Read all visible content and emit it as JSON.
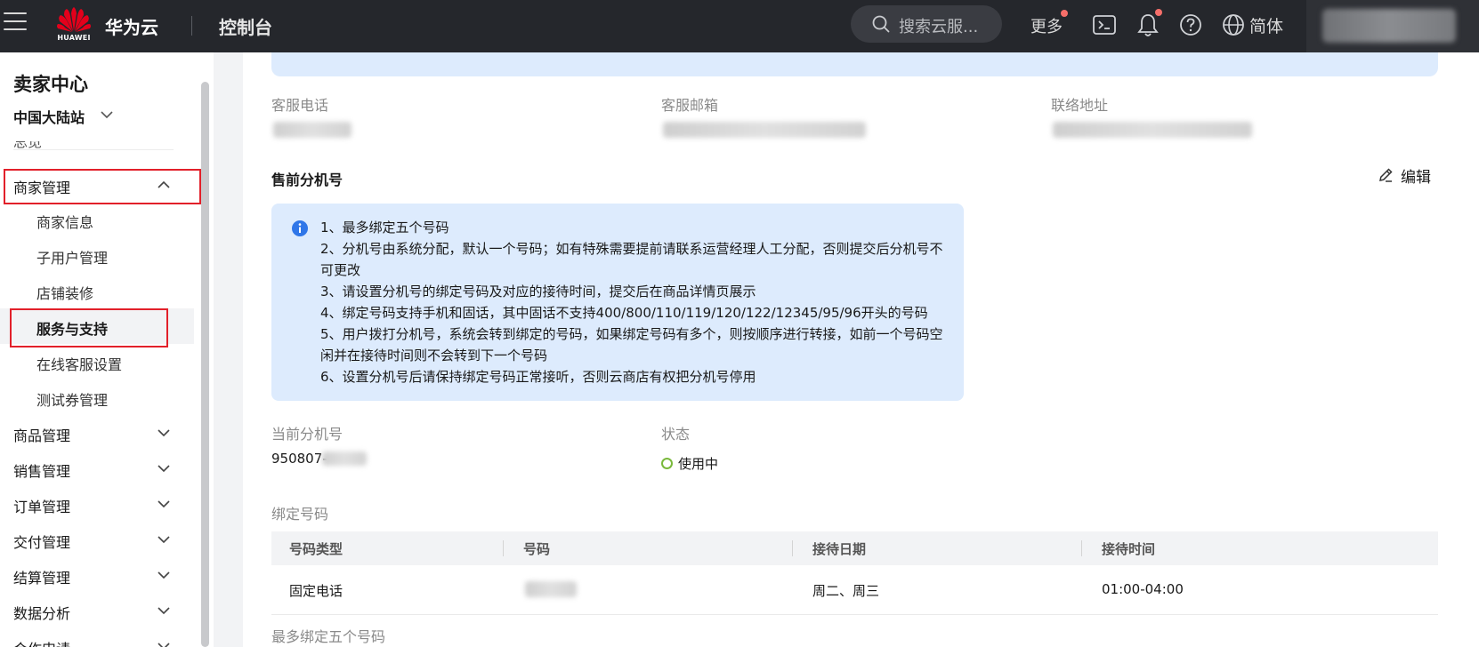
{
  "topbar": {
    "logo_text": "HUAWEI",
    "brand": "华为云",
    "console": "控制台",
    "search_placeholder": "搜索云服...",
    "more": "更多",
    "language": "简体",
    "icons": [
      "menu-icon",
      "search-icon",
      "terminal-icon",
      "bell-icon",
      "help-icon",
      "globe-icon"
    ]
  },
  "sidebar": {
    "title": "卖家中心",
    "site": "中国大陆站",
    "cut_item": "总览",
    "groups": {
      "merchant": "商家管理",
      "goods": "商品管理",
      "sales": "销售管理",
      "orders": "订单管理",
      "delivery": "交付管理",
      "settlement": "结算管理",
      "analytics": "数据分析",
      "cooperation": "合作申请"
    },
    "subitems": {
      "info": "商家信息",
      "subuser": "子用户管理",
      "decoration": "店铺装修",
      "service": "服务与支持",
      "online_cs": "在线客服设置",
      "coupon": "测试券管理"
    }
  },
  "main": {
    "labels": {
      "phone": "客服电话",
      "email": "客服邮箱",
      "address": "联络地址"
    },
    "section_title": "售前分机号",
    "edit": "编辑",
    "notice_lines": [
      "1、最多绑定五个号码",
      "2、分机号由系统分配，默认一个号码；如有特殊需要提前请联系运营经理人工分配，否则提交后分机号不可更改",
      "3、请设置分机号的绑定号码及对应的接待时间，提交后在商品详情页展示",
      "4、绑定号码支持手机和固话，其中固话不支持400/800/110/119/120/122/12345/95/96开头的号码",
      "5、用户拨打分机号，系统会转到绑定的号码，如果绑定号码有多个，则按顺序进行转接，如前一个号码空闲并在接待时间则不会转到下一个号码",
      "6、设置分机号后请保持绑定号码正常接听，否则云商店有权把分机号停用"
    ],
    "current_ext_label": "当前分机号",
    "current_ext_value": "950807-",
    "status_label": "状态",
    "status_value": "使用中",
    "status_color": "#7ab93c",
    "bind_label": "绑定号码",
    "table": {
      "headers": [
        "号码类型",
        "号码",
        "接待日期",
        "接待时间"
      ],
      "rows": [
        {
          "type": "固定电话",
          "number": "",
          "days": "周二、周三",
          "time": "01:00-04:00"
        }
      ]
    },
    "max_bind": "最多绑定五个号码"
  }
}
